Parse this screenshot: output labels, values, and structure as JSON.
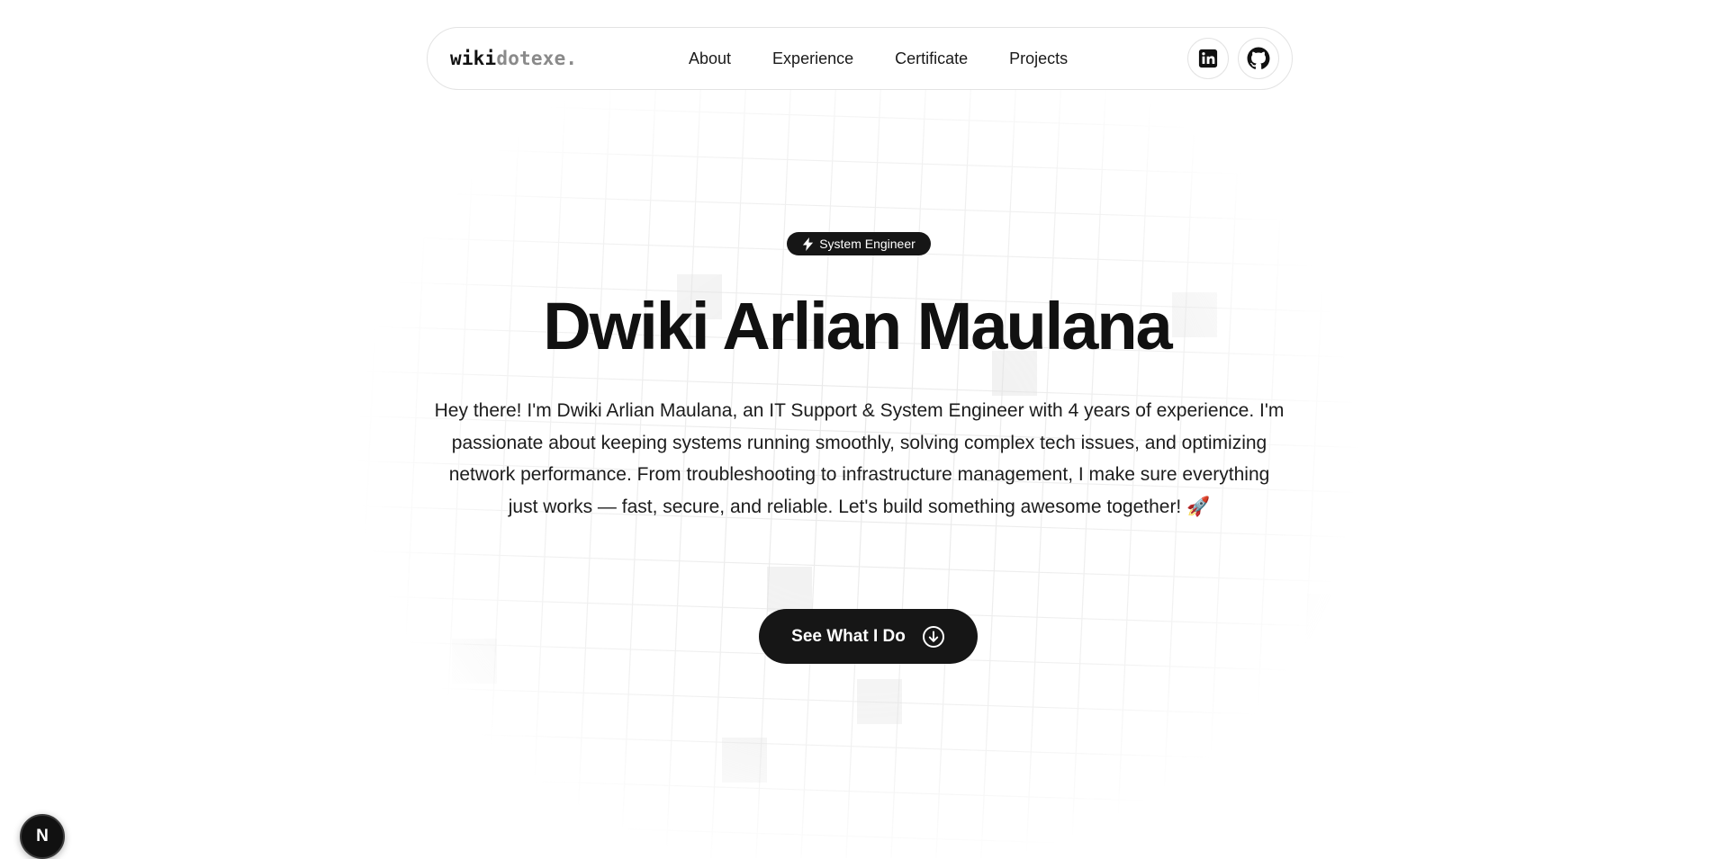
{
  "navbar": {
    "logo_primary": "wiki",
    "logo_secondary": "dotexe.",
    "links": [
      "About",
      "Experience",
      "Certificate",
      "Projects"
    ],
    "icons": [
      "linkedin-icon",
      "github-icon"
    ]
  },
  "hero": {
    "badge_icon": "lightning-icon",
    "badge_label": "System Engineer",
    "title": "Dwiki Arlian Maulana",
    "description": "Hey there! I'm Dwiki Arlian Maulana, an IT Support & System Engineer with 4 years of experience. I'm passionate about keeping systems running smoothly, solving complex tech issues, and optimizing network performance. From troubleshooting to infrastructure management, I make sure everything just works — fast, secure, and reliable. Let's build something awesome together! 🚀",
    "cta_label": "See What I Do",
    "cta_icon": "arrow-down-circle-icon"
  },
  "framework_badge": {
    "label": "N"
  },
  "colors": {
    "primary_dark": "#161616",
    "grid_line": "#ececec",
    "secondary_text": "#8a8a8a"
  }
}
